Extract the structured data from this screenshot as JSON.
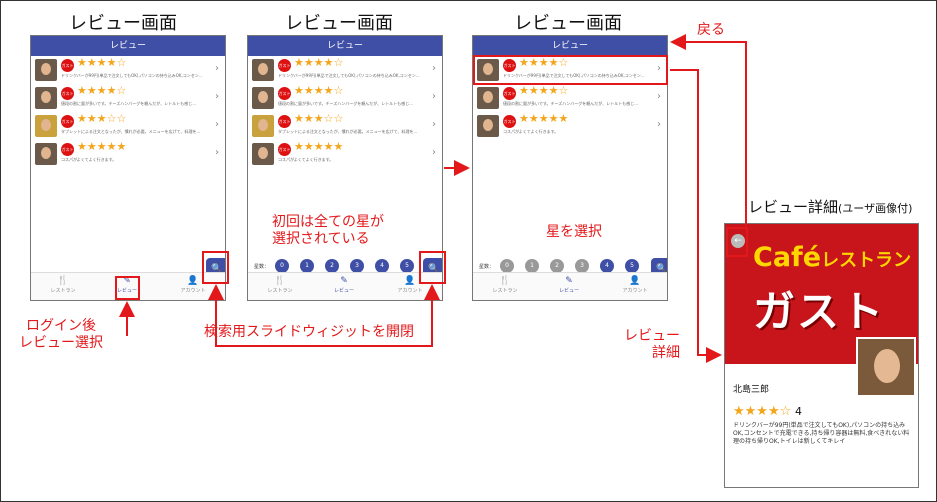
{
  "screens": [
    {
      "title": "レビュー画面",
      "appbar": "レビュー"
    },
    {
      "title": "レビュー画面",
      "appbar": "レビュー"
    },
    {
      "title": "レビュー画面",
      "appbar": "レビュー"
    }
  ],
  "reviews": [
    {
      "stars": "★★★★☆",
      "comment": "ドリンクバーが99円(単品で注文してもOK),パソコンの持ち込みOK,コンセン..."
    },
    {
      "stars": "★★★★☆",
      "comment": "値段の割に量が多いです。チーズハンバーグを頼んだが、レトルトも感じ..."
    },
    {
      "stars": "★★★☆☆",
      "comment": "タブレットによる注文となったが、慣れが必要。メニューを広げて、料理を..."
    },
    {
      "stars": "★★★★★",
      "comment": "コスパがよくてよく行きます。"
    }
  ],
  "screen3_reviews": [
    {
      "stars": "★★★★☆",
      "comment": "ドリンクバーが99円(単品で注文してもOK),パソコンの持ち込みOK,コンセン..."
    },
    {
      "stars": "★★★★☆",
      "comment": "値段の割に量が多いです。チーズハンバーグを頼んだが、レトルトも感じ..."
    },
    {
      "stars": "★★★★★",
      "comment": "コスパがよくてよく行きます。"
    }
  ],
  "logo_badge": "ガスト",
  "nav": {
    "restaurant": "レストラン",
    "review": "レビュー",
    "account": "アカウント"
  },
  "slider": {
    "label": "星数：",
    "values": [
      "0",
      "1",
      "2",
      "3",
      "4",
      "5"
    ]
  },
  "annotations": {
    "login": "ログイン後\nレビュー選択",
    "slide_widget": "検索用スライドウィジットを開閉",
    "initial": "初回は全ての星が\n選択されている",
    "select_star": "星を選択",
    "back": "戻る",
    "to_detail": "レビュー\n詳細"
  },
  "detail": {
    "title": "レビュー詳細",
    "title_note": "(ユーザ画像付)",
    "hero_cafe": "Café",
    "hero_cafe_small": "レストラン",
    "hero_brand": "ガスト",
    "user_name": "北島三郎",
    "stars": "★★★★☆",
    "score": "4",
    "comment": "ドリンクバーが99円(単品で注文してもOK),パソコンの持ち込みOK,コンセントで充電できる,持ち帰り容器は無料,食べきれない料理の持ち帰りOK,トイレは新しくてキレイ"
  },
  "colors": {
    "accent": "#3f4fa6",
    "annotation": "#e3181b",
    "star": "#f3a51b"
  }
}
